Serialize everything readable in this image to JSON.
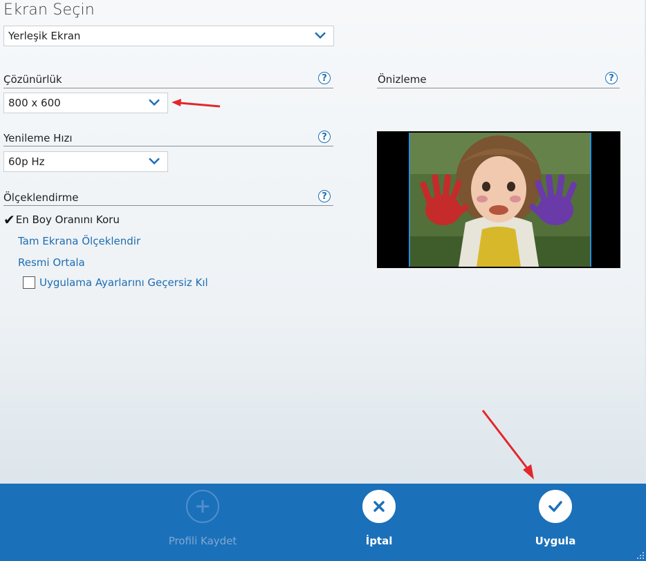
{
  "title": "Ekran Seçin",
  "display_select": {
    "value": "Yerleşik Ekran",
    "icon": "chevron-down-icon"
  },
  "resolution": {
    "label": "Çözünürlük",
    "value": "800 x 600",
    "help": "?"
  },
  "refresh": {
    "label": "Yenileme Hızı",
    "value": "60p Hz",
    "help": "?"
  },
  "scaling": {
    "label": "Ölçeklendirme",
    "help": "?",
    "options": [
      {
        "label": "En Boy Oranını Koru",
        "selected": true
      },
      {
        "label": "Tam Ekrana Ölçeklendir",
        "selected": false
      },
      {
        "label": "Resmi Ortala",
        "selected": false
      }
    ],
    "override_label": "Uygulama Ayarlarını Geçersiz Kıl",
    "override_checked": false
  },
  "preview": {
    "label": "Önizleme",
    "help": "?"
  },
  "bottom": {
    "save_label": "Profili Kaydet",
    "cancel_label": "İptal",
    "apply_label": "Uygula"
  },
  "colors": {
    "accent": "#1b70ba",
    "link": "#1d6db1",
    "annotation_arrow": "#e3262b"
  }
}
